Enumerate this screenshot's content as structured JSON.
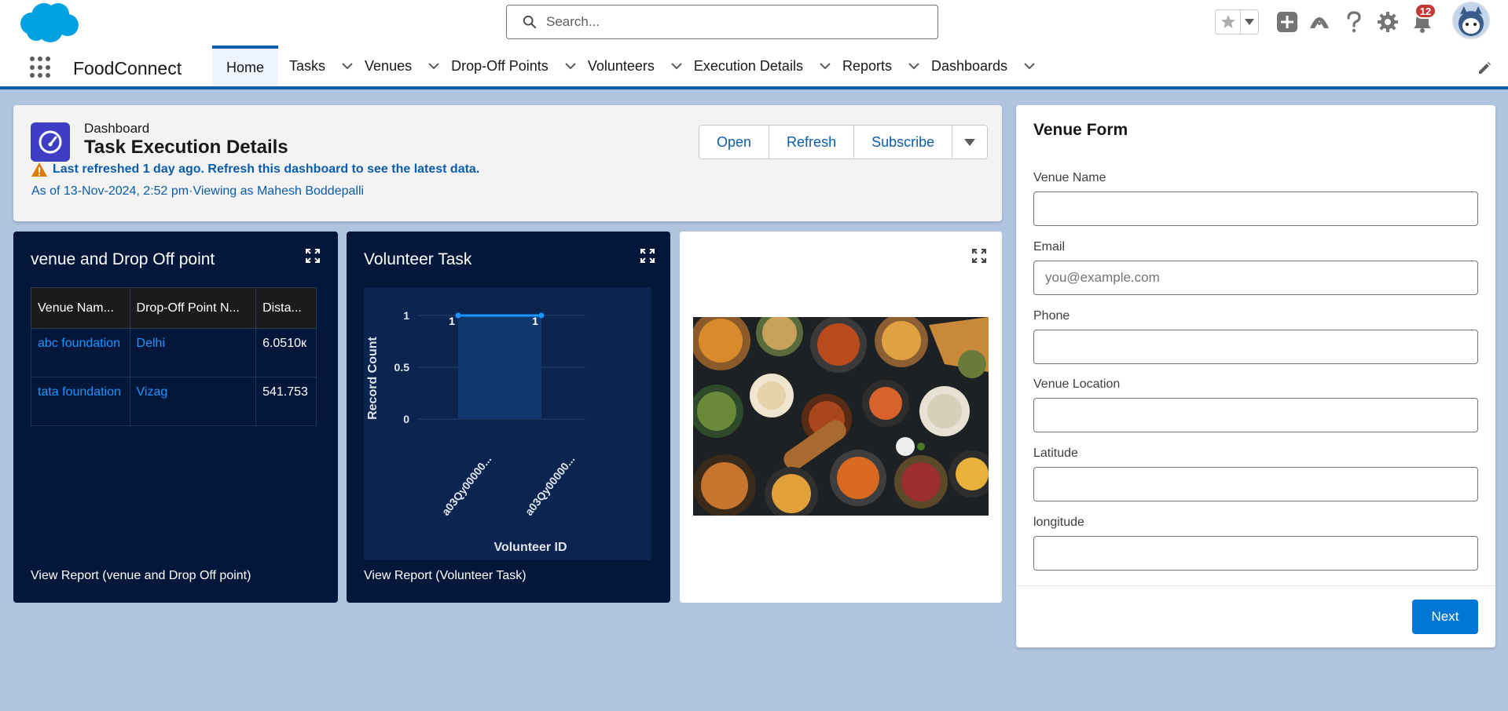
{
  "header": {
    "search_placeholder": "Search...",
    "notification_count": "12",
    "icons": [
      "salesforce-cloud-icon",
      "search-icon",
      "star-icon",
      "chevron-down-icon",
      "add-icon",
      "trailhead-icon",
      "help-icon",
      "gear-icon",
      "bell-icon",
      "avatar-icon"
    ]
  },
  "nav": {
    "app_name": "FoodConnect",
    "items": [
      {
        "label": "Home"
      },
      {
        "label": "Tasks"
      },
      {
        "label": "Venues"
      },
      {
        "label": "Drop-Off Points"
      },
      {
        "label": "Volunteers"
      },
      {
        "label": "Execution Details"
      },
      {
        "label": "Reports"
      },
      {
        "label": "Dashboards"
      }
    ]
  },
  "dashboard": {
    "kicker": "Dashboard",
    "title": "Task Execution Details",
    "warning": "Last refreshed 1 day ago. Refresh this dashboard to see the latest data.",
    "as_of": "As of 13-Nov-2024, 2:52 pm·Viewing as Mahesh Boddepalli",
    "buttons": {
      "open": "Open",
      "refresh": "Refresh",
      "subscribe": "Subscribe"
    }
  },
  "widget1": {
    "title": "venue and Drop Off point",
    "columns": [
      "Venue Nam...",
      "Drop-Off Point N...",
      "Dista..."
    ],
    "rows": [
      [
        "abc foundation",
        "Delhi",
        "6.0510к"
      ],
      [
        "tata foundation",
        "Vizag",
        "541.753"
      ]
    ],
    "footer": "View Report (venue and Drop Off point)"
  },
  "widget2": {
    "title": "Volunteer Task",
    "footer": "View Report (Volunteer Task)"
  },
  "chart_data": {
    "type": "area",
    "title": "Volunteer Task",
    "xlabel": "Volunteer ID",
    "ylabel": "Record Count",
    "categories": [
      "a03Qy00000...",
      "a03Qy00000..."
    ],
    "values": [
      1,
      1
    ],
    "data_labels": [
      "1",
      "1"
    ],
    "yticks": [
      "0",
      "0.5",
      "1"
    ],
    "ylim": [
      0,
      1
    ],
    "grid": true,
    "color": "#1b96ff"
  },
  "venue_form": {
    "title": "Venue Form",
    "fields": [
      {
        "label": "Venue Name",
        "placeholder": ""
      },
      {
        "label": "Email",
        "placeholder": "you@example.com"
      },
      {
        "label": "Phone",
        "placeholder": ""
      },
      {
        "label": "Venue Location",
        "placeholder": ""
      },
      {
        "label": "Latitude",
        "placeholder": ""
      },
      {
        "label": "longitude",
        "placeholder": ""
      }
    ],
    "next_label": "Next"
  },
  "colors": {
    "brand_blue": "#0b5cab",
    "button_blue": "#0176d3",
    "widget_dark": "#03173a",
    "page_bg": "#b0c4df",
    "badge_red": "#c23934",
    "warning_orange": "#dd7a01"
  }
}
